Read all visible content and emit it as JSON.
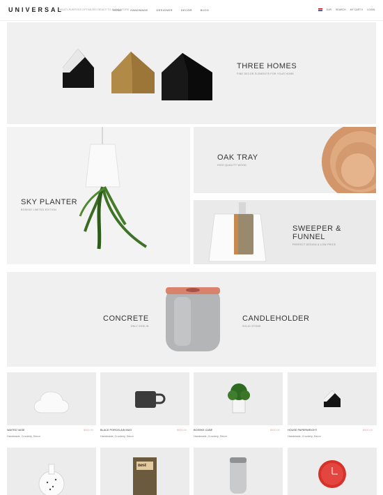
{
  "header": {
    "logo": "UNIVERSAL",
    "tagline": "MULTI-PURPOSE OPTIMIZED READY TO SHOP STORE",
    "nav": [
      "HOME",
      "HANDMADE",
      "DESIGNER",
      "DECOR",
      "BLOG"
    ],
    "currency": "EUR",
    "tools": [
      "SEARCH",
      "MY CART 0",
      "LOGIN"
    ]
  },
  "hero1": {
    "title": "THREE HOMES",
    "subtitle": "FINE DECOR ELEMENTS FOR YOUR HOME"
  },
  "hero2": {
    "title": "SKY PLANTER",
    "subtitle": "BOSKKE LIMITED EDITION"
  },
  "hero3": {
    "title": "OAK TRAY",
    "subtitle": "HIGH QUALITY WOOD"
  },
  "hero4": {
    "title": "SWEEPER & FUNNEL",
    "subtitle": "PERFECT DESIGN & LOW PRICE"
  },
  "hero5": {
    "title_left": "CONCRETE",
    "subtitle_left": "ONLY SHELIN",
    "title_right": "CANDLEHOLDER",
    "subtitle_right": "SOLID STONE"
  },
  "products": [
    {
      "name": "WAITED VASE",
      "price": "$000.00",
      "cats": "Handmade, Crockery, Decor"
    },
    {
      "name": "BLACK PORCELAIN MUG",
      "price": "$000.00",
      "cats": "Handmade, Crockery, Decor"
    },
    {
      "name": "BOSSKE CUBE",
      "price": "$000.00",
      "cats": "Handmade, Crockery, Decor"
    },
    {
      "name": "HOUSE PAPERWEIGHT",
      "price": "$000.00",
      "cats": "Handmade, Crockery, Decor"
    }
  ],
  "book": {
    "title": "nest"
  },
  "colors": {
    "accent": "#d9a59a",
    "panel": "#efefef"
  }
}
